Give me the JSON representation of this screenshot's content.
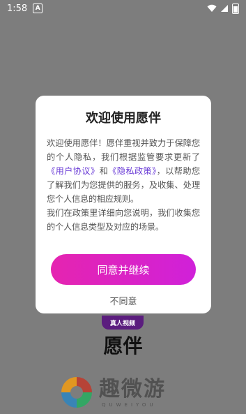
{
  "status_bar": {
    "time": "1:58",
    "notification_icon": "app-notification-icon",
    "wifi_icon": "wifi-icon",
    "signal_icon": "signal-icon",
    "battery_icon": "battery-icon"
  },
  "background": {
    "app_icon_label": "真人视频",
    "app_name": "愿伴",
    "watermark_cn": "趣微游",
    "watermark_en": "QUWEIYOU"
  },
  "dialog": {
    "title": "欢迎使用愿伴",
    "body_p1_part1": "欢迎使用愿伴！愿伴重视并致力于保障您的个人隐私，我们根据监管要求更新了",
    "link_user_agreement": "《用户协议》",
    "and_text": "和",
    "link_privacy_policy": "《隐私政策》",
    "body_p1_part2": "，以帮助您了解我们为您提供的服务，及收集、处理您个人信息的相应规则。",
    "body_p2": "我们在政策里详细向您说明，我们收集您的个人信息类型及对应的场景。",
    "agree_button": "同意并继续",
    "disagree_button": "不同意"
  },
  "colors": {
    "overlay": "#7d7d7d",
    "accent_start": "#e524b0",
    "accent_end": "#d021d9",
    "link": "#6a3bd6"
  }
}
